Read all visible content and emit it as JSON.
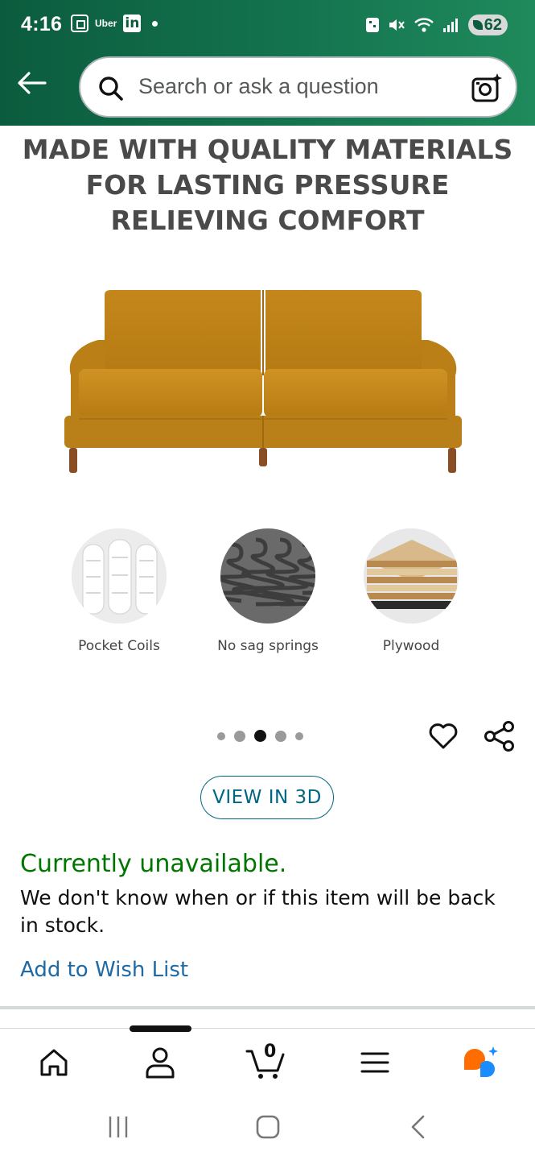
{
  "status_bar": {
    "time": "4:16",
    "uber_label": "Uber",
    "linkedin_label": "in",
    "battery_level": "62"
  },
  "search": {
    "placeholder": "Search or ask a question"
  },
  "product": {
    "headline_lines": [
      "MADE WITH QUALITY MATERIALS",
      "FOR LASTING PRESSURE",
      "RELIEVING COMFORT"
    ],
    "sofa_color": "#c98a1a",
    "materials": [
      {
        "label": "Pocket Coils"
      },
      {
        "label": "No sag springs"
      },
      {
        "label": "Plywood"
      }
    ]
  },
  "carousel": {
    "total_dots": 5,
    "active_index": 2
  },
  "actions": {
    "view_3d_label": "VIEW IN 3D"
  },
  "availability": {
    "status": "Currently unavailable.",
    "description": "We don't know when or if this item will be back in stock.",
    "wishlist_label": "Add to Wish List"
  },
  "bottom_nav": {
    "items": [
      "home-icon",
      "account-icon",
      "cart-icon",
      "menu-icon",
      "rufus-icon"
    ],
    "cart_count": "0",
    "active_item": "account-icon"
  },
  "colors": {
    "header_green": "#0b5c3e",
    "link_blue": "#1f6aa5",
    "available_green": "#007600",
    "view3d_teal": "#006782"
  }
}
